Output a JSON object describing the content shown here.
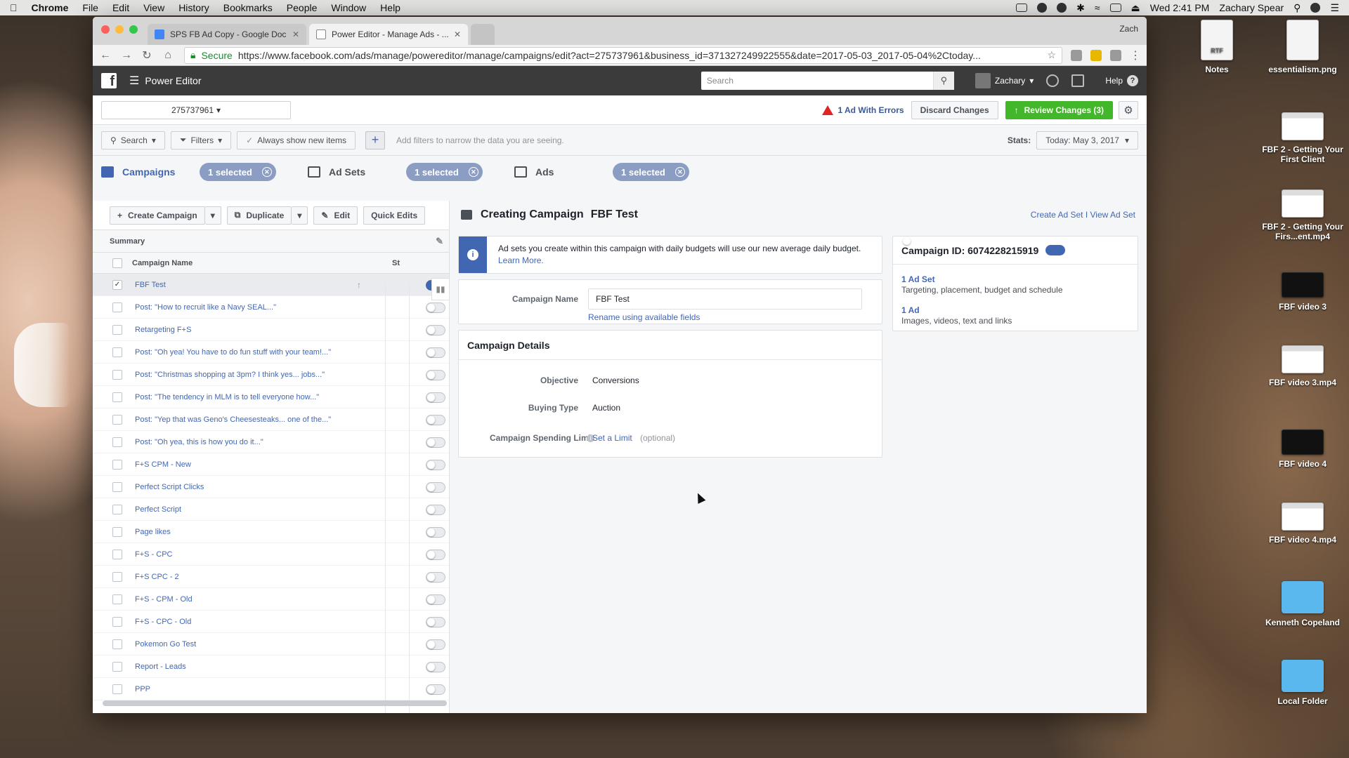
{
  "menubar": {
    "app": "Chrome",
    "items": [
      "File",
      "Edit",
      "View",
      "History",
      "Bookmarks",
      "People",
      "Window",
      "Help"
    ],
    "clock": "Wed 2:41 PM",
    "user": "Zachary Spear"
  },
  "desktop": {
    "icons": [
      {
        "label": "Notes",
        "kind": "doc"
      },
      {
        "label": "essentialism.png",
        "kind": "doc"
      },
      {
        "label": "FBF 2 - Getting Your First Client",
        "kind": "shot"
      },
      {
        "label": "FBF 2 - Getting Your Firs...ent.mp4",
        "kind": "shot"
      },
      {
        "label": "FBF video 3",
        "kind": "video"
      },
      {
        "label": "FBF video 3.mp4",
        "kind": "shot"
      },
      {
        "label": "FBF video 4",
        "kind": "video"
      },
      {
        "label": "FBF video 4.mp4",
        "kind": "shot"
      },
      {
        "label": "Kenneth Copeland",
        "kind": "folder"
      },
      {
        "label": "Local Folder",
        "kind": "folder"
      }
    ],
    "notes_badge": "RTF"
  },
  "browser": {
    "tabs": [
      {
        "title": "SPS FB Ad Copy - Google Doc",
        "favicon_color": "#4285f4"
      },
      {
        "title": "Power Editor - Manage Ads - ...",
        "favicon_color": "#3b5998"
      }
    ],
    "profile": "Zach",
    "secure_label": "Secure",
    "url": "https://www.facebook.com/ads/manage/powereditor/manage/campaigns/edit?act=275737961&business_id=371327249922555&date=2017-05-03_2017-05-04%2Ctoday..."
  },
  "fb": {
    "app_title": "Power Editor",
    "search_placeholder": "Search",
    "user": "Zachary",
    "help": "Help",
    "account_id": "275737961",
    "errors": "1 Ad With Errors",
    "discard": "Discard Changes",
    "review": "Review Changes (3)",
    "filters": {
      "search": "Search",
      "filters": "Filters",
      "always_show": "Always show new items",
      "hint": "Add filters to narrow the data you are seeing.",
      "stats_label": "Stats:",
      "stats_value": "Today: May 3, 2017"
    },
    "levels": [
      {
        "name": "Campaigns",
        "selected": "1 selected"
      },
      {
        "name": "Ad Sets",
        "selected": "1 selected"
      },
      {
        "name": "Ads",
        "selected": "1 selected"
      }
    ],
    "toolbar": {
      "create": "Create Campaign",
      "duplicate": "Duplicate",
      "edit": "Edit",
      "quick_edits": "Quick Edits"
    },
    "summary": "Summary",
    "col_name": "Campaign Name",
    "col_status": "St",
    "campaigns": [
      {
        "name": "FBF Test",
        "on": true,
        "selected": true
      },
      {
        "name": "Post: \"How to recruit like a Navy SEAL...\"",
        "on": false
      },
      {
        "name": "Retargeting F+S",
        "on": false
      },
      {
        "name": "Post: \"Oh yea! You have to do fun stuff with your team!...\"",
        "on": false
      },
      {
        "name": "Post: \"Christmas shopping at 3pm? I think yes... jobs...\"",
        "on": false
      },
      {
        "name": "Post: \"The tendency in MLM is to tell everyone how...\"",
        "on": false
      },
      {
        "name": "Post: \"Yep that was Geno's Cheesesteaks... one of the...\"",
        "on": false
      },
      {
        "name": "Post: \"Oh yea, this is how you do it...\"",
        "on": false
      },
      {
        "name": "F+S CPM - New",
        "on": false
      },
      {
        "name": "Perfect Script Clicks",
        "on": false
      },
      {
        "name": "Perfect Script",
        "on": false
      },
      {
        "name": "Page likes",
        "on": false
      },
      {
        "name": "F+S - CPC",
        "on": false
      },
      {
        "name": "F+S CPC - 2",
        "on": false
      },
      {
        "name": "F+S - CPM - Old",
        "on": false
      },
      {
        "name": "F+S - CPC - Old",
        "on": false
      },
      {
        "name": "Pokemon Go Test",
        "on": false
      },
      {
        "name": "Report - Leads",
        "on": false
      },
      {
        "name": "PPP",
        "on": false
      }
    ],
    "editor": {
      "heading": "Creating Campaign",
      "campaign_name": "FBF Test",
      "links": "Create Ad Set I View Ad Set",
      "notice": "Ad sets you create within this campaign with daily budgets will use our new average daily budget.",
      "learn_more": "Learn More.",
      "name_label": "Campaign Name",
      "rename": "Rename using available fields",
      "details_title": "Campaign Details",
      "objective_label": "Objective",
      "objective": "Conversions",
      "buying_label": "Buying Type",
      "buying": "Auction",
      "limit_label": "Campaign Spending Limit",
      "limit_link": "Set a Limit",
      "limit_optional": "(optional)",
      "campaign_id": "Campaign ID: 6074228215919",
      "adset_title": "1 Ad Set",
      "adset_desc": "Targeting, placement, budget and schedule",
      "ad_title": "1 Ad",
      "ad_desc": "Images, videos, text and links"
    }
  }
}
